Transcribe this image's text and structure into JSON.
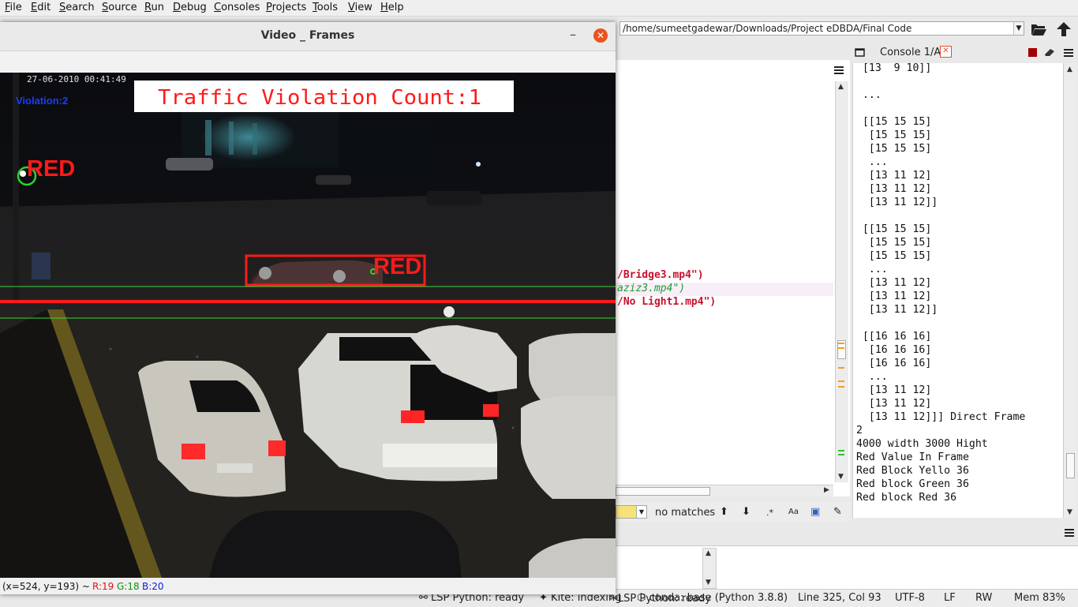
{
  "menubar": {
    "items": [
      "File",
      "Edit",
      "Search",
      "Source",
      "Run",
      "Debug",
      "Consoles",
      "Projects",
      "Tools",
      "View",
      "Help"
    ],
    "mnemonics": [
      "F",
      "E",
      "S",
      "S",
      "R",
      "D",
      "C",
      "P",
      "T",
      "V",
      "H"
    ]
  },
  "toolbar": {
    "working_dir": "/home/sumeetgadewar/Downloads/Project eDBDA/Final Code"
  },
  "video_window": {
    "title": "Video _ Frames",
    "overlay": {
      "timestamp": "27-06-2010 00:41:49",
      "violation_label": "Violation:2",
      "counter_text": "Traffic Violation Count:1",
      "signal_label": "RED",
      "car_label": "RED"
    },
    "status": {
      "coords": "(x=524, y=193) ~",
      "r": "R:19",
      "g": "G:18",
      "b": "B:20"
    },
    "colors": {
      "overlay_red": "#ff1a1a",
      "line_green": "#39d43a",
      "signal_green": "#2bd42b"
    }
  },
  "editor": {
    "code_lines": [
      "/Bridge3.mp4\")",
      "aziz3.mp4\")",
      "/No Light1.mp4\")"
    ],
    "find": {
      "status": "no matches"
    }
  },
  "console": {
    "tab_label": "Console 1/A",
    "lines": [
      " [13  9 10]]",
      "",
      " ...",
      "",
      " [[15 15 15]",
      "  [15 15 15]",
      "  [15 15 15]",
      "  ...",
      "  [13 11 12]",
      "  [13 11 12]",
      "  [13 11 12]]",
      "",
      " [[15 15 15]",
      "  [15 15 15]",
      "  [15 15 15]",
      "  ...",
      "  [13 11 12]",
      "  [13 11 12]",
      "  [13 11 12]]",
      "",
      " [[16 16 16]",
      "  [16 16 16]",
      "  [16 16 16]",
      "  ...",
      "  [13 11 12]",
      "  [13 11 12]",
      "  [13 11 12]]] Direct Frame",
      "2",
      "4000 width 3000 Hight",
      "Red Value In Frame",
      "Red Block Yello 36",
      "Red block Green 36",
      "Red block Red 36"
    ]
  },
  "statusbar": {
    "lsp": "LSP Python: ready",
    "kite": "Kite: indexing",
    "conda": "conda: base (Python 3.8.8)",
    "position": "Line 325, Col 93",
    "encoding": "UTF-8",
    "eol": "LF",
    "mode": "RW",
    "memory": "Mem 83%"
  }
}
